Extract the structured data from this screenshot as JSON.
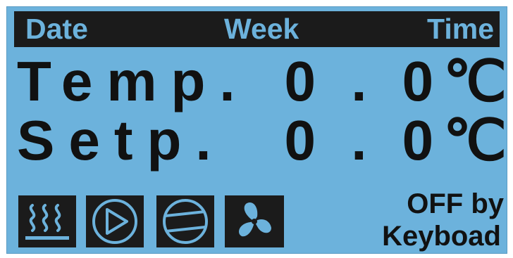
{
  "header": {
    "date_label": "Date",
    "week_label": "Week",
    "time_label": "Time"
  },
  "temp": {
    "label": "Temp.",
    "value": "0 . 0",
    "unit": "℃"
  },
  "setpoint": {
    "label": "Setp.",
    "value": "0 . 0",
    "unit": "℃"
  },
  "status_icons": [
    "heater-icon",
    "play-icon",
    "compressor-icon",
    "fan-icon"
  ],
  "status": {
    "line1": "OFF by",
    "line2": "Keyboad"
  },
  "colors": {
    "lcd_background": "#6cb2dc",
    "segment_dark": "#1b1b1b"
  }
}
